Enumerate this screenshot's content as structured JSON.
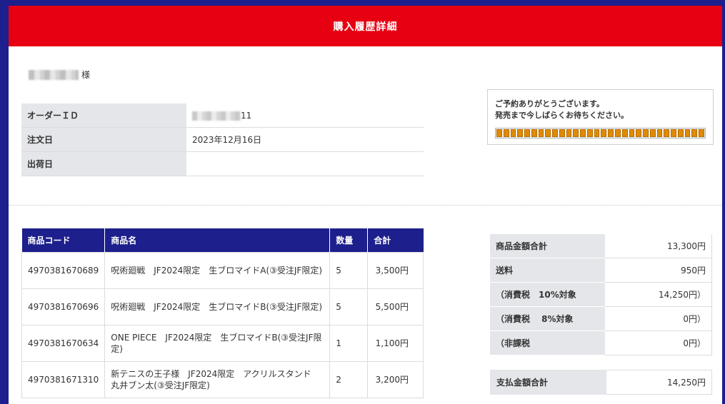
{
  "header": {
    "title": "購入履歴詳細"
  },
  "customer": {
    "suffix": "様"
  },
  "order_info": {
    "rows": [
      {
        "label": "オーダーＩＤ",
        "value": "11"
      },
      {
        "label": "注文日",
        "value": "2023年12月16日"
      },
      {
        "label": "出荷日",
        "value": ""
      }
    ]
  },
  "notice": {
    "line1": "ご予約ありがとうございます。",
    "line2": "発売まで今しばらくお待ちください。",
    "progress_fraction": 1.0,
    "progress_color": "#e08a00"
  },
  "items": {
    "headers": {
      "code": "商品コード",
      "name": "商品名",
      "qty": "数量",
      "total": "合計"
    },
    "rows": [
      {
        "code": "4970381670689",
        "name": "呪術廻戦　JF2024限定　生ブロマイドA(③受注JF限定)",
        "qty": "5",
        "total": "3,500円"
      },
      {
        "code": "4970381670696",
        "name": "呪術廻戦　JF2024限定　生ブロマイドB(③受注JF限定)",
        "qty": "5",
        "total": "5,500円"
      },
      {
        "code": "4970381670634",
        "name": "ONE PIECE　JF2024限定　生ブロマイドB(③受注JF限定)",
        "qty": "1",
        "total": "1,100円"
      },
      {
        "code": "4970381671310",
        "name": "新テニスの王子様　JF2024限定　アクリルスタンド　丸井ブン太(③受注JF限定)",
        "qty": "2",
        "total": "3,200円"
      }
    ]
  },
  "summary": {
    "rows": [
      {
        "label": "商品金額合計",
        "value": "13,300円"
      },
      {
        "label": "送料",
        "value": "950円"
      },
      {
        "label": "（消費税　10%対象",
        "value": "14,250円）"
      },
      {
        "label": "（消費税　 8%対象",
        "value": "0円）"
      },
      {
        "label": "（非課税",
        "value": "0円）"
      }
    ],
    "payment": {
      "label": "支払金額合計",
      "value": "14,250円"
    }
  },
  "colors": {
    "header_red": "#e60012",
    "navy": "#1c1f8c",
    "label_gray": "#e4e6e9"
  }
}
